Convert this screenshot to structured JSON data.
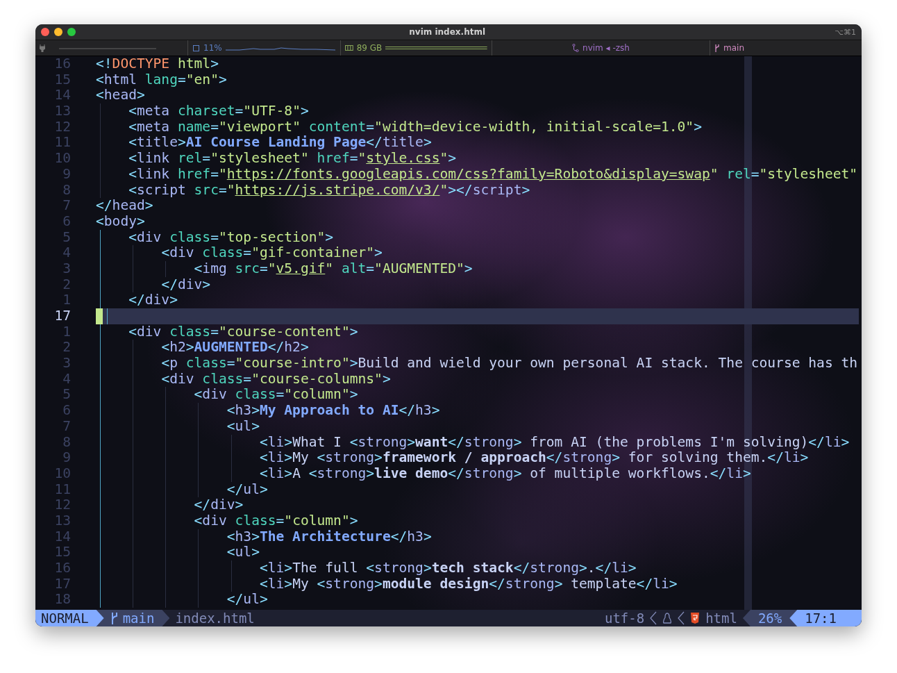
{
  "window": {
    "title": "nvim index.html",
    "shortcut": "⌥⌘1"
  },
  "tab_bar": {
    "cpu": "11%",
    "memory": "89 GB",
    "session": "nvim ◂ -zsh",
    "branch": "main"
  },
  "editor": {
    "lines": [
      {
        "number": "16",
        "text": "<!DOCTYPE html>",
        "kind": "markup",
        "current": false,
        "scope": false
      },
      {
        "number": "15",
        "text": "<html lang=\"en\">",
        "kind": "markup",
        "current": false,
        "scope": false
      },
      {
        "number": "14",
        "text": "<head>",
        "kind": "markup",
        "current": false,
        "scope": false
      },
      {
        "number": "13",
        "text": "    <meta charset=\"UTF-8\">",
        "kind": "markup",
        "current": false,
        "scope": false
      },
      {
        "number": "12",
        "text": "    <meta name=\"viewport\" content=\"width=device-width, initial-scale=1.0\">",
        "kind": "markup",
        "current": false,
        "scope": false
      },
      {
        "number": "11",
        "text": "    <title>AI Course Landing Page</title>",
        "kind": "heading",
        "current": false,
        "scope": false
      },
      {
        "number": "10",
        "text": "    <link rel=\"stylesheet\" href=\"style.css\">",
        "kind": "markup",
        "current": false,
        "scope": false,
        "underline_first_value": false,
        "underline_second_value": true
      },
      {
        "number": "9",
        "text": "    <link href=\"https://fonts.googleapis.com/css?family=Roboto&display=swap\" rel=\"stylesheet\"",
        "kind": "markup",
        "current": false,
        "scope": false,
        "underline_first_value": true,
        "underline_second_value": false
      },
      {
        "number": "8",
        "text": "    <script src=\"https://js.stripe.com/v3/\"></script>",
        "kind": "markup",
        "current": false,
        "scope": false,
        "underline_first_value": true
      },
      {
        "number": "7",
        "text": "</head>",
        "kind": "markup",
        "current": false,
        "scope": false
      },
      {
        "number": "6",
        "text": "<body>",
        "kind": "markup",
        "current": false,
        "scope": false
      },
      {
        "number": "5",
        "text": "    <div class=\"top-section\">",
        "kind": "markup",
        "current": false,
        "scope": true
      },
      {
        "number": "4",
        "text": "        <div class=\"gif-container\">",
        "kind": "markup",
        "current": false,
        "scope": true
      },
      {
        "number": "3",
        "text": "            <img src=\"v5.gif\" alt=\"AUGMENTED\">",
        "kind": "markup",
        "current": false,
        "scope": true,
        "underline_first_value": true,
        "underline_second_value": false
      },
      {
        "number": "2",
        "text": "        </div>",
        "kind": "markup",
        "current": false,
        "scope": true
      },
      {
        "number": "1",
        "text": "    </div>",
        "kind": "markup",
        "current": false,
        "scope": true
      },
      {
        "number": "17",
        "kind": "markup",
        "current": true,
        "scope": true
      },
      {
        "number": "1",
        "text": "    <div class=\"course-content\">",
        "kind": "markup",
        "current": false,
        "scope": true
      },
      {
        "number": "2",
        "text": "        <h2>AUGMENTED</h2>",
        "kind": "heading",
        "current": false,
        "scope": true
      },
      {
        "number": "3",
        "text": "        <p class=\"course-intro\">Build and wield your own personal AI stack. The course has th",
        "kind": "markup",
        "current": false,
        "scope": true
      },
      {
        "number": "4",
        "text": "        <div class=\"course-columns\">",
        "kind": "markup",
        "current": false,
        "scope": true
      },
      {
        "number": "5",
        "text": "            <div class=\"column\">",
        "kind": "markup",
        "current": false,
        "scope": true
      },
      {
        "number": "6",
        "text": "                <h3>My Approach to AI</h3>",
        "kind": "heading",
        "current": false,
        "scope": true
      },
      {
        "number": "7",
        "text": "                <ul>",
        "kind": "markup",
        "current": false,
        "scope": true
      },
      {
        "number": "8",
        "text": "                    <li>What I <strong>want</strong> from AI (the problems I'm solving)</li>",
        "kind": "markup",
        "current": false,
        "scope": true
      },
      {
        "number": "9",
        "text": "                    <li>My <strong>framework / approach</strong> for solving them.</li>",
        "kind": "markup",
        "current": false,
        "scope": true
      },
      {
        "number": "10",
        "text": "                    <li>A <strong>live demo</strong> of multiple workflows.</li>",
        "kind": "markup",
        "current": false,
        "scope": true
      },
      {
        "number": "11",
        "text": "                </ul>",
        "kind": "markup",
        "current": false,
        "scope": true
      },
      {
        "number": "12",
        "text": "            </div>",
        "kind": "markup",
        "current": false,
        "scope": true
      },
      {
        "number": "13",
        "text": "            <div class=\"column\">",
        "kind": "markup",
        "current": false,
        "scope": true
      },
      {
        "number": "14",
        "text": "                <h3>The Architecture</h3>",
        "kind": "heading",
        "current": false,
        "scope": true
      },
      {
        "number": "15",
        "text": "                <ul>",
        "kind": "markup",
        "current": false,
        "scope": true
      },
      {
        "number": "16",
        "text": "                    <li>The full <strong>tech stack</strong>.</li>",
        "kind": "markup",
        "current": false,
        "scope": true
      },
      {
        "number": "17",
        "text": "                    <li>My <strong>module design</strong> template</li>",
        "kind": "markup",
        "current": false,
        "scope": true
      },
      {
        "number": "18",
        "text": "                </ul>",
        "kind": "markup",
        "current": false,
        "scope": true
      }
    ]
  },
  "status_line": {
    "mode": "NORMAL",
    "branch": "main",
    "file": "index.html",
    "encoding": "utf-8",
    "filetype": "html",
    "progress": "26%",
    "position": "17:1"
  }
}
